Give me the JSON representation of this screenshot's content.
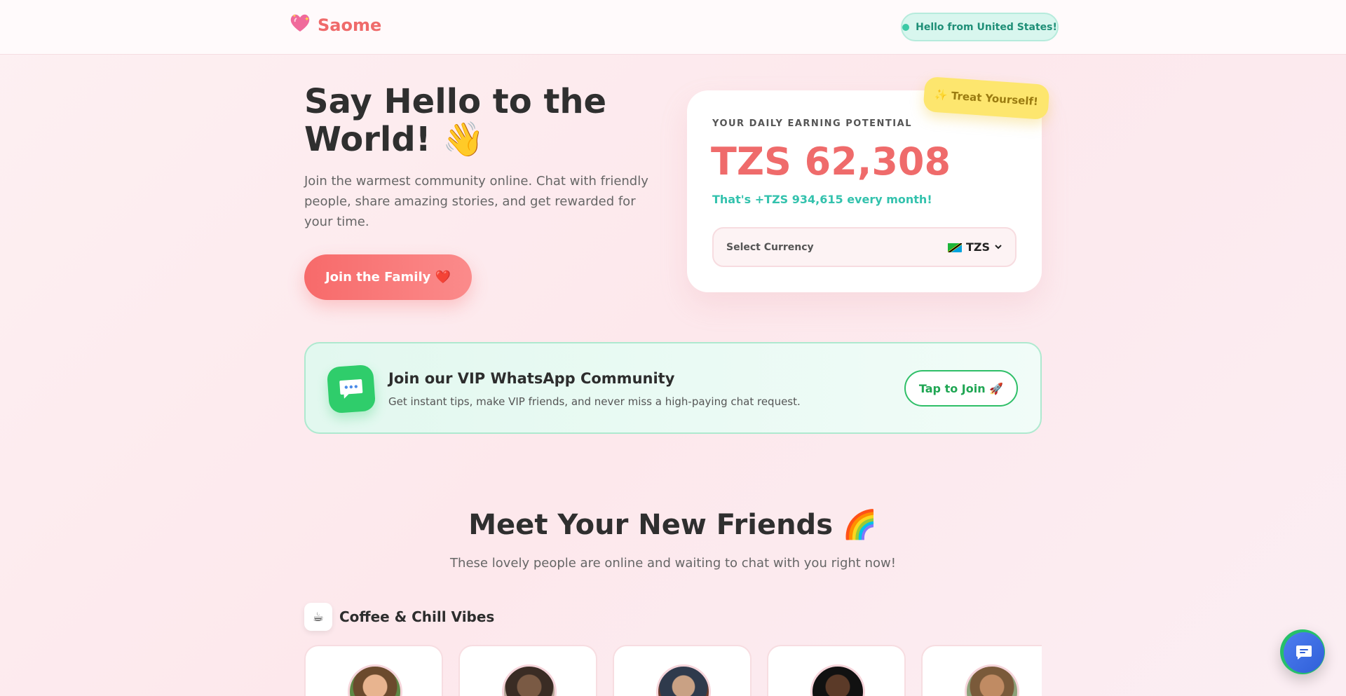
{
  "header": {
    "brand": "Saome",
    "geo_badge": "Hello from United States!"
  },
  "hero": {
    "title_line1": "Say Hello to the",
    "title_line2": "World! 👋",
    "subtitle": "Join the warmest community online. Chat with friendly people, share amazing stories, and get rewarded for your time.",
    "join_button": "Join the Family ❤️"
  },
  "earnings": {
    "badge": "✨ Treat Yourself!",
    "label": "YOUR DAILY EARNING POTENTIAL",
    "value": "TZS 62,308",
    "monthly": "That's +TZS 934,615 every month!",
    "select_label": "Select Currency",
    "selected_currency": "TZS"
  },
  "whatsapp": {
    "title": "Join our VIP WhatsApp Community",
    "subtitle": "Get instant tips, make VIP friends, and never miss a high-paying chat request.",
    "button": "Tap to Join 🚀"
  },
  "friends": {
    "title": "Meet Your New Friends 🌈",
    "subtitle": "These lovely people are online and waiting to chat with you right now!",
    "category_icon": "☕",
    "category_label": "Coffee & Chill Vibes"
  },
  "colors": {
    "brand": "#ef6b6b",
    "accent_teal": "#33c2ad",
    "whatsapp_green": "#2fcd6b",
    "badge_yellow": "#fde66e",
    "chat_blue": "#2f5fd8"
  }
}
